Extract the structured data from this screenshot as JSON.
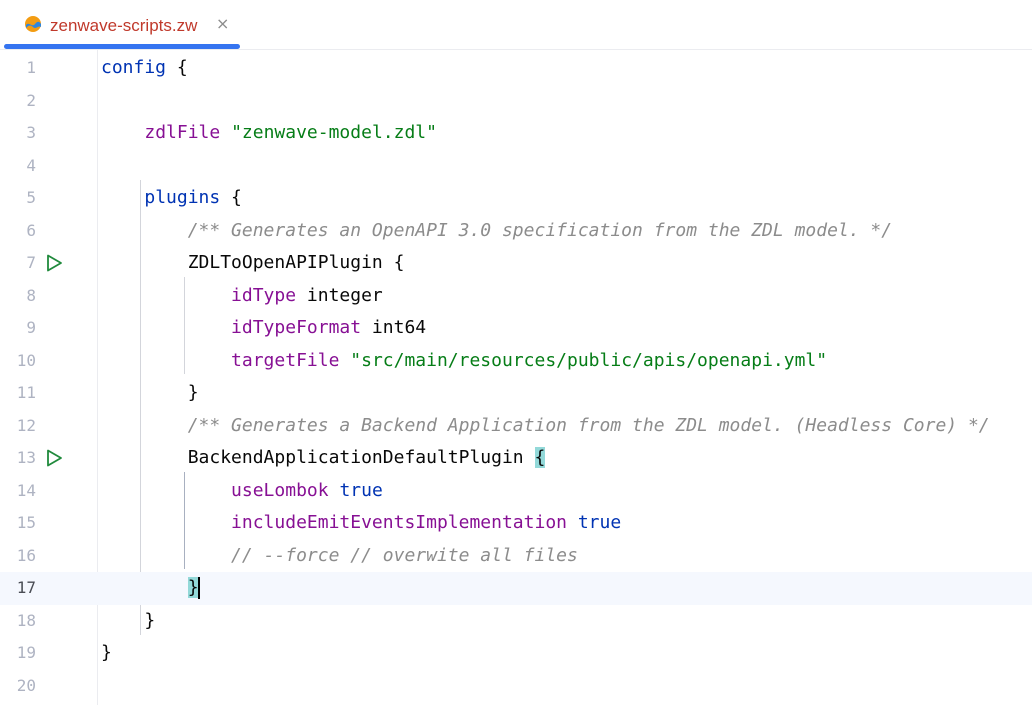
{
  "tab": {
    "label": "zenwave-scripts.zw",
    "close": "×",
    "icon": "zenwave-file-icon"
  },
  "colors": {
    "keyword": "#0033b3",
    "property": "#871094",
    "string": "#067d17",
    "comment": "#8c8c8c",
    "accent": "#3574f0"
  },
  "editor": {
    "current_line": 17,
    "lines": [
      {
        "n": "1",
        "tokens": [
          {
            "t": "config",
            "c": "kw"
          },
          {
            "t": " {",
            "c": "plain"
          }
        ]
      },
      {
        "n": "2",
        "tokens": []
      },
      {
        "n": "3",
        "tokens": [
          {
            "t": "    ",
            "c": "plain"
          },
          {
            "t": "zdlFile",
            "c": "prop"
          },
          {
            "t": " ",
            "c": "plain"
          },
          {
            "t": "\"zenwave-model.zdl\"",
            "c": "str"
          }
        ]
      },
      {
        "n": "4",
        "tokens": []
      },
      {
        "n": "5",
        "tokens": [
          {
            "t": "    ",
            "c": "plain"
          },
          {
            "t": "plugins",
            "c": "kw"
          },
          {
            "t": " {",
            "c": "plain"
          }
        ]
      },
      {
        "n": "6",
        "tokens": [
          {
            "t": "        ",
            "c": "plain"
          },
          {
            "t": "/** Generates an OpenAPI 3.0 specification from the ZDL model. */",
            "c": "cmt"
          }
        ]
      },
      {
        "n": "7",
        "run": true,
        "tokens": [
          {
            "t": "        ",
            "c": "plain"
          },
          {
            "t": "ZDLToOpenAPIPlugin",
            "c": "plain"
          },
          {
            "t": " {",
            "c": "plain"
          }
        ]
      },
      {
        "n": "8",
        "tokens": [
          {
            "t": "            ",
            "c": "plain"
          },
          {
            "t": "idType",
            "c": "prop"
          },
          {
            "t": " integer",
            "c": "plain"
          }
        ]
      },
      {
        "n": "9",
        "tokens": [
          {
            "t": "            ",
            "c": "plain"
          },
          {
            "t": "idTypeFormat",
            "c": "prop"
          },
          {
            "t": " int64",
            "c": "plain"
          }
        ]
      },
      {
        "n": "10",
        "tokens": [
          {
            "t": "            ",
            "c": "plain"
          },
          {
            "t": "targetFile",
            "c": "prop"
          },
          {
            "t": " ",
            "c": "plain"
          },
          {
            "t": "\"src/main/resources/public/apis/openapi.yml\"",
            "c": "str"
          }
        ]
      },
      {
        "n": "11",
        "tokens": [
          {
            "t": "        ",
            "c": "plain"
          },
          {
            "t": "}",
            "c": "plain"
          }
        ]
      },
      {
        "n": "12",
        "tokens": [
          {
            "t": "        ",
            "c": "plain"
          },
          {
            "t": "/** Generates a Backend Application from the ZDL model. (Headless Core) */",
            "c": "cmt"
          }
        ]
      },
      {
        "n": "13",
        "run": true,
        "tokens": [
          {
            "t": "        ",
            "c": "plain"
          },
          {
            "t": "BackendApplicationDefaultPlugin",
            "c": "plain"
          },
          {
            "t": " ",
            "c": "plain"
          },
          {
            "t": "{",
            "c": "brace-hl"
          }
        ]
      },
      {
        "n": "14",
        "tokens": [
          {
            "t": "            ",
            "c": "plain"
          },
          {
            "t": "useLombok",
            "c": "prop"
          },
          {
            "t": " ",
            "c": "plain"
          },
          {
            "t": "true",
            "c": "kw"
          }
        ]
      },
      {
        "n": "15",
        "tokens": [
          {
            "t": "            ",
            "c": "plain"
          },
          {
            "t": "includeEmitEventsImplementation",
            "c": "prop"
          },
          {
            "t": " ",
            "c": "plain"
          },
          {
            "t": "true",
            "c": "kw"
          }
        ]
      },
      {
        "n": "16",
        "tokens": [
          {
            "t": "            ",
            "c": "plain"
          },
          {
            "t": "// --force // overwite all files",
            "c": "cmt"
          }
        ]
      },
      {
        "n": "17",
        "tokens": [
          {
            "t": "        ",
            "c": "plain"
          },
          {
            "t": "}",
            "c": "brace-hl"
          },
          {
            "t": "",
            "c": "caret"
          }
        ]
      },
      {
        "n": "18",
        "tokens": [
          {
            "t": "    ",
            "c": "plain"
          },
          {
            "t": "}",
            "c": "plain"
          }
        ]
      },
      {
        "n": "19",
        "tokens": [
          {
            "t": "}",
            "c": "plain"
          }
        ]
      },
      {
        "n": "20",
        "tokens": []
      }
    ]
  }
}
